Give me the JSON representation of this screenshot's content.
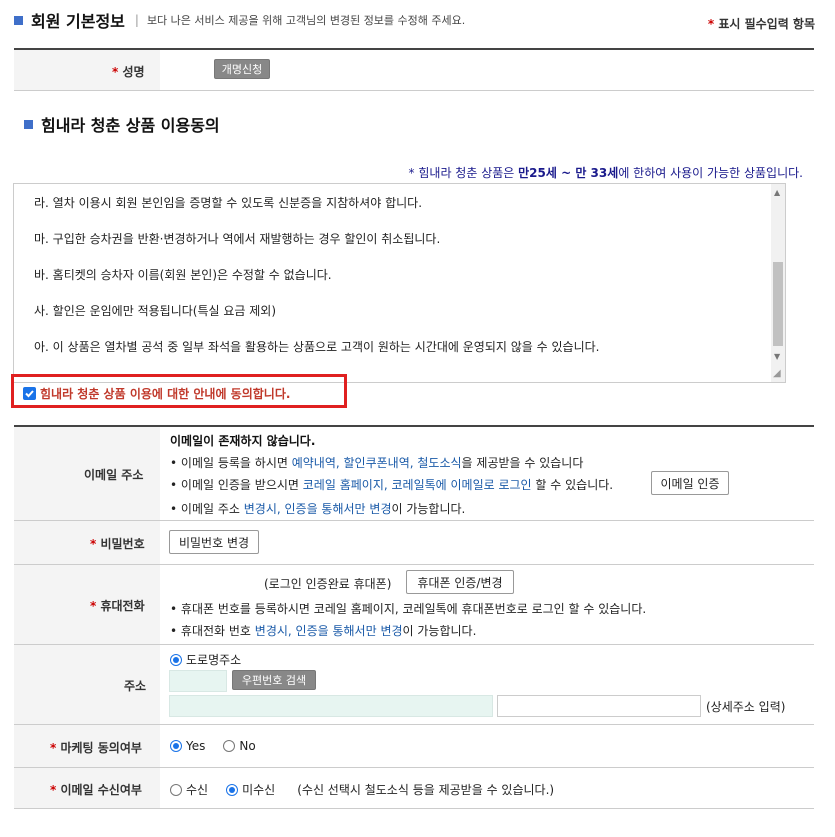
{
  "header": {
    "title": "회원 기본정보",
    "separator": "|",
    "description": "보다 나은 서비스 제공을 위해 고객님의 변경된 정보를 수정해 주세요.",
    "required_mark": "*",
    "required_note": "표시 필수입력 항목"
  },
  "name_row": {
    "mark": "*",
    "label": "성명",
    "button": "개명신청"
  },
  "section2": {
    "title": "힘내라 청춘 상품 이용동의",
    "notice_prefix": "* 힘내라 청춘 상품은 ",
    "notice_age1": "만25세",
    "notice_tilde": " ~ ",
    "notice_age2": "만 33세",
    "notice_suffix": "에 한하여 사용이 가능한 상품입니다.",
    "lines": [
      "라. 열차 이용시 회원 본인임을 증명할 수 있도록 신분증을 지참하셔야 합니다.",
      "마. 구입한 승차권을 반환·변경하거나 역에서 재발행하는 경우 할인이 취소됩니다.",
      "바. 홈티켓의 승차자 이름(회원 본인)은 수정할 수 없습니다.",
      "사. 할인은 운임에만 적용됩니다(특실 요금 제외)",
      "아. 이 상품은 열차별 공석 중 일부 좌석을 활용하는 상품으로 고객이 원하는 시간대에 운영되지 않을 수 있습니다."
    ],
    "checkbox_label": "힘내라 청춘 상품 이용에 대한 안내에 동의합니다.",
    "checkbox_checked": true
  },
  "email": {
    "label": "이메일 주소",
    "status": "이메일이 존재하지 않습니다.",
    "b1_pre": "이메일 등록을 하시면 ",
    "b1_link": "예약내역, 할인쿠폰내역, 철도소식",
    "b1_post": "을 제공받을 수 있습니다",
    "b2_pre": "이메일 인증을 받으시면 ",
    "b2_link": "코레일 홈페이지, 코레일톡에 이메일로 로그인",
    "b2_post": " 할 수 있습니다.",
    "verify_button": "이메일 인증",
    "b3_pre": "이메일 주소 ",
    "b3_link": "변경시, 인증을 통해서만 변경",
    "b3_post": "이 가능합니다."
  },
  "password": {
    "mark": "*",
    "label": "비밀번호",
    "button": "비밀번호 변경"
  },
  "phone": {
    "mark": "*",
    "label": "휴대전화",
    "login_note": "(로그인 인증완료 휴대폰)",
    "button": "휴대폰 인증/변경",
    "b1": "휴대폰 번호를 등록하시면 코레일 홈페이지, 코레일톡에 휴대폰번호로 로그인 할 수 있습니다.",
    "b2_pre": "휴대전화 번호 ",
    "b2_link": "변경시, 인증을 통해서만 변경",
    "b2_post": "이 가능합니다."
  },
  "address": {
    "label": "주소",
    "radio_label": "도로명주소",
    "search_button": "우편번호 검색",
    "detail_note": "(상세주소 입력)"
  },
  "marketing": {
    "mark": "*",
    "label": "마케팅 동의여부",
    "yes": "Yes",
    "no": "No",
    "selected": "Yes"
  },
  "email_receive": {
    "mark": "*",
    "label": "이메일 수신여부",
    "opt1": "수신",
    "opt2": "미수신",
    "note": "(수신 선택시 철도소식 등을 제공받을 수 있습니다.)",
    "selected": "미수신"
  },
  "colors": {
    "accent_blue": "#3f6fc9",
    "required_red": "#cc0000",
    "link_blue": "#1a5aa8",
    "highlight_red": "#e02020",
    "notice_navy": "#1a1a8c"
  }
}
